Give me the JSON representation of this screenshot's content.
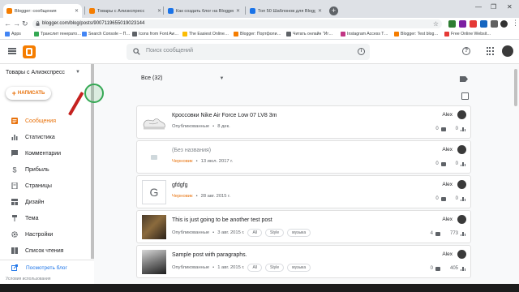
{
  "browser": {
    "tabs": [
      {
        "title": "Blogger: сообщения",
        "active": true,
        "favicon_color": "#f57d00"
      },
      {
        "title": "Товары с Алиэкспресс",
        "active": false,
        "favicon_color": "#f57d00"
      },
      {
        "title": "Как создать блог на Blogger 20…",
        "active": false,
        "favicon_color": "#1a73e8"
      },
      {
        "title": "Топ 50 Шаблонов для Blogger ….",
        "active": false,
        "favicon_color": "#1a73e8"
      }
    ],
    "new_tab_glyph": "+",
    "window_controls": [
      "—",
      "❐",
      "✕"
    ],
    "url": "blogger.com/blog/posts/9007119655019023144",
    "bookmarks": [
      {
        "label": "Apps",
        "color": "#4285f4"
      },
      {
        "label": "Транслит генерато…",
        "color": "#34a853"
      },
      {
        "label": "Search Console – П…",
        "color": "#4285f4"
      },
      {
        "label": "Icons from Font Aw…",
        "color": "#5f6368"
      },
      {
        "label": "The Easiest Online…",
        "color": "#fbbc04"
      },
      {
        "label": "Blogger: Портфоли…",
        "color": "#f57d00"
      },
      {
        "label": "Читать онлайн \"Иг…",
        "color": "#5f6368"
      },
      {
        "label": "Instagram Access T…",
        "color": "#c13584"
      },
      {
        "label": "Blogger: Test blog…",
        "color": "#f57d00"
      },
      {
        "label": "Free Online Websit…",
        "color": "#e53935"
      }
    ]
  },
  "header": {
    "search_placeholder": "Поиск сообщений"
  },
  "sidebar": {
    "blog_name": "Товары с Алиэкспресс",
    "new_post_label": "НАПИСАТЬ",
    "items": [
      {
        "label": "Сообщения",
        "icon": "posts-icon",
        "active": true
      },
      {
        "label": "Статистика",
        "icon": "stats-icon",
        "active": false
      },
      {
        "label": "Комментарии",
        "icon": "comments-icon",
        "active": false
      },
      {
        "label": "Прибыль",
        "icon": "dollar-icon",
        "active": false
      },
      {
        "label": "Страницы",
        "icon": "pages-icon",
        "active": false
      },
      {
        "label": "Дизайн",
        "icon": "layout-icon",
        "active": false
      },
      {
        "label": "Тема",
        "icon": "theme-icon",
        "active": false
      },
      {
        "label": "Настройки",
        "icon": "settings-icon",
        "active": false
      },
      {
        "label": "Список чтения",
        "icon": "reading-list-icon",
        "active": false
      }
    ],
    "view_blog_label": "Посмотреть блог",
    "terms_label": "Условия использования"
  },
  "main": {
    "filter_label": "Все (32)",
    "posts": [
      {
        "title": "Кроссовки Nike Air Force Low 07 LV8 3m",
        "status": "Опубликованные",
        "status_type": "published",
        "date": "8 дек.",
        "labels": [],
        "author": "Alex",
        "comments": "0",
        "views": "0",
        "thumb": "sneaker"
      },
      {
        "title": "(Без названия)",
        "status": "Черновик",
        "status_type": "draft",
        "date": "13 июл. 2017 г.",
        "labels": [],
        "author": "Alex",
        "comments": "0",
        "views": "0",
        "thumb": "small"
      },
      {
        "title": "gfdgfg",
        "status": "Черновик",
        "status_type": "draft",
        "date": "28 авг. 2015 г.",
        "labels": [],
        "author": "Alex",
        "comments": "0",
        "views": "0",
        "thumb": "letter",
        "thumb_letter": "G"
      },
      {
        "title": "This is just going to be another test post",
        "status": "Опубликованные",
        "status_type": "published",
        "date": "3 авг. 2015 г.",
        "labels": [
          "All",
          "Style",
          "музыка"
        ],
        "author": "Alex",
        "comments": "4",
        "views": "773",
        "thumb": "photo-dark"
      },
      {
        "title": "Sample post with paragraphs.",
        "status": "Опубликованные",
        "status_type": "published",
        "date": "1 авг. 2015 г.",
        "labels": [
          "All",
          "Style",
          "музыка"
        ],
        "author": "Alex",
        "comments": "0",
        "views": "405",
        "thumb": "photo-grey"
      }
    ]
  },
  "colors": {
    "accent": "#e8710a",
    "blogger_orange": "#f57d00",
    "link_blue": "#1a73e8"
  }
}
